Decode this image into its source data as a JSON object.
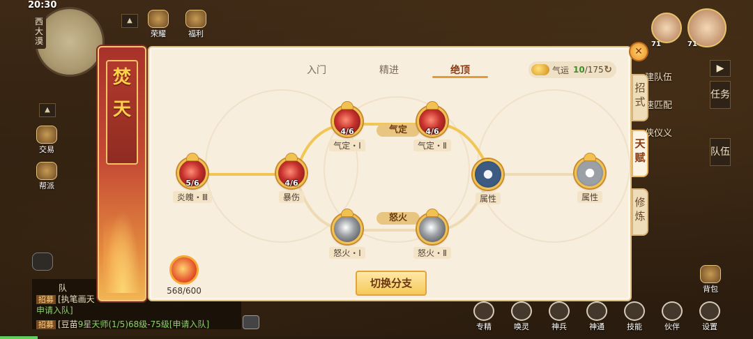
{
  "hud": {
    "time": "20:30",
    "map_name": "西大漠",
    "top_icons": [
      {
        "label": "荣耀",
        "icon": "trophy-icon"
      },
      {
        "label": "福利",
        "icon": "gift-icon"
      }
    ],
    "side_icons": [
      {
        "label": "交易",
        "icon": "trade-icon"
      },
      {
        "label": "帮派",
        "icon": "guild-icon"
      }
    ],
    "right_tabs": [
      "任务",
      "队伍"
    ],
    "team_menu": [
      "建队伍",
      "速匹配",
      "侠仪义"
    ],
    "avatar_levels": [
      "71",
      "71"
    ],
    "bag_label": "背包",
    "bottom_icons": [
      {
        "label": "专精",
        "icon": "tiger-icon"
      },
      {
        "label": "唤灵",
        "icon": "eye-icon"
      },
      {
        "label": "神兵",
        "icon": "weapon-icon"
      },
      {
        "label": "神通",
        "icon": "spirit-icon"
      },
      {
        "label": "技能",
        "icon": "book-icon"
      },
      {
        "label": "伙伴",
        "icon": "partner-icon"
      },
      {
        "label": "设置",
        "icon": "gear-icon"
      }
    ],
    "chat": [
      {
        "tag": "招募",
        "text": "[执笔画天",
        "extra": "申请入队]"
      },
      {
        "tag": "招募",
        "text": "[豆苗",
        "extra": "9星天师(1/5)68级-75级[申请入队]"
      }
    ],
    "chat_header": "队",
    "exp_progress": 0.05
  },
  "panel": {
    "banner_title": [
      "焚",
      "天"
    ],
    "tabs": [
      {
        "label": "入门",
        "active": false
      },
      {
        "label": "精进",
        "active": false
      },
      {
        "label": "绝顶",
        "active": true
      }
    ],
    "qiyun": {
      "label": "气运",
      "current": "10",
      "max": "/175"
    },
    "branches": [
      {
        "label": "气定"
      },
      {
        "label": "怒火"
      }
    ],
    "nodes": [
      {
        "id": "yanpo",
        "label": "炎魄・Ⅲ",
        "count": "5/6",
        "style": "red"
      },
      {
        "id": "baoshang",
        "label": "暴伤",
        "count": "4/6",
        "style": "red"
      },
      {
        "id": "qiding1",
        "label": "气定・Ⅰ",
        "count": "4/6",
        "style": "red"
      },
      {
        "id": "qiding2",
        "label": "气定・Ⅱ",
        "count": "4/6",
        "style": "red"
      },
      {
        "id": "nuhuo1",
        "label": "怒火・Ⅰ",
        "count": "",
        "style": "gray"
      },
      {
        "id": "nuhuo2",
        "label": "怒火・Ⅱ",
        "count": "",
        "style": "gray"
      },
      {
        "id": "shuxing1",
        "label": "属性",
        "count": "",
        "style": "blue"
      },
      {
        "id": "shuxing2",
        "label": "属性",
        "count": "",
        "style": "white"
      }
    ],
    "energy": {
      "value": "568/600"
    },
    "switch_button": "切换分支",
    "side_tabs": [
      {
        "label": "招式",
        "active": false
      },
      {
        "label": "天赋",
        "active": true
      },
      {
        "label": "修炼",
        "active": false
      }
    ]
  }
}
